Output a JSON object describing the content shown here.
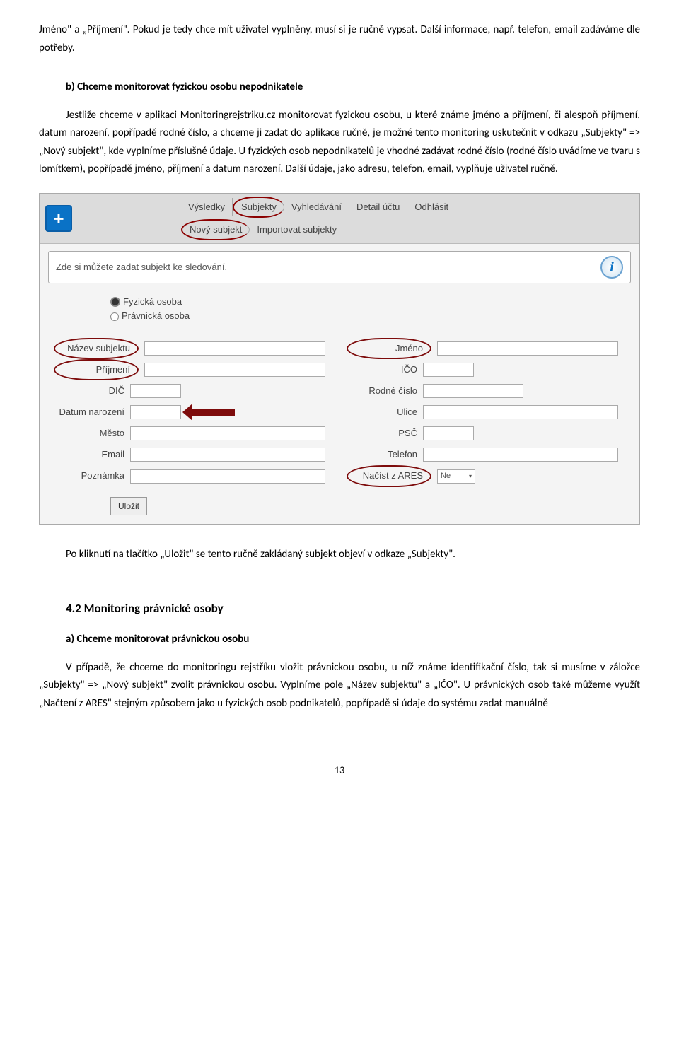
{
  "para1": "Jméno\" a „Příjmení\". Pokud je tedy chce mít uživatel vyplněny, musí si je ručně vypsat.   Další informace, např. telefon, email zadáváme dle potřeby.",
  "sub_b": "b)   Chceme monitorovat fyzickou osobu nepodnikatele",
  "para2": "Jestliže chceme v aplikaci Monitoringrejstriku.cz monitorovat fyzickou osobu, u které známe jméno a příjmení, či alespoň příjmení, datum narození, popřípadě rodné číslo, a chceme ji zadat do aplikace ručně, je možné tento monitoring uskutečnit v odkazu „Subjekty\" => „Nový subjekt\", kde vyplníme příslušné údaje. U fyzických osob nepodnikatelů je vhodné zadávat rodné číslo (rodné číslo uvádíme ve tvaru s lomítkem), popřípadě jméno, příjmení a datum narození. Další údaje, jako adresu, telefon, email, vyplňuje uživatel ručně.",
  "screenshot": {
    "menu_top": [
      "Výsledky",
      "Subjekty",
      "Vyhledávání",
      "Detail účtu",
      "Odhlásit"
    ],
    "menu_sub": [
      "Nový subjekt",
      "Importovat subjekty"
    ],
    "hint": "Zde si můžete zadat subjekt ke sledování.",
    "radio1": "Fyzická osoba",
    "radio2": "Právnická osoba",
    "labels": {
      "nazev": "Název subjektu",
      "jmeno": "Jméno",
      "prijmeni": "Příjmení",
      "ico": "IČO",
      "dic": "DIČ",
      "rodne": "Rodné číslo",
      "datum": "Datum narození",
      "ulice": "Ulice",
      "mesto": "Město",
      "psc": "PSČ",
      "email": "Email",
      "telefon": "Telefon",
      "poznamka": "Poznámka",
      "ares": "Načíst z ARES",
      "ares_val": "Ne"
    },
    "save": "Uložit"
  },
  "after_shot": "Po kliknutí na tlačítko „Uložit\" se tento ručně zakládaný subjekt objeví v odkaze „Subjekty\".",
  "h3": "4.2 Monitoring právnické osoby",
  "list_a": "a)   Chceme monitorovat právnickou osobu",
  "para3": "V případě, že chceme do monitoringu rejstříku vložit právnickou osobu, u níž známe identifikační číslo, tak si musíme v záložce „Subjekty\" => „Nový subjekt\" zvolit právnickou osobu. Vyplníme pole „Název subjektu\" a „IČO\". U právnických osob také můžeme využít „Načtení z ARES\" stejným způsobem jako u fyzických osob podnikatelů, popřípadě si údaje do systému zadat manuálně",
  "page_num": "13"
}
